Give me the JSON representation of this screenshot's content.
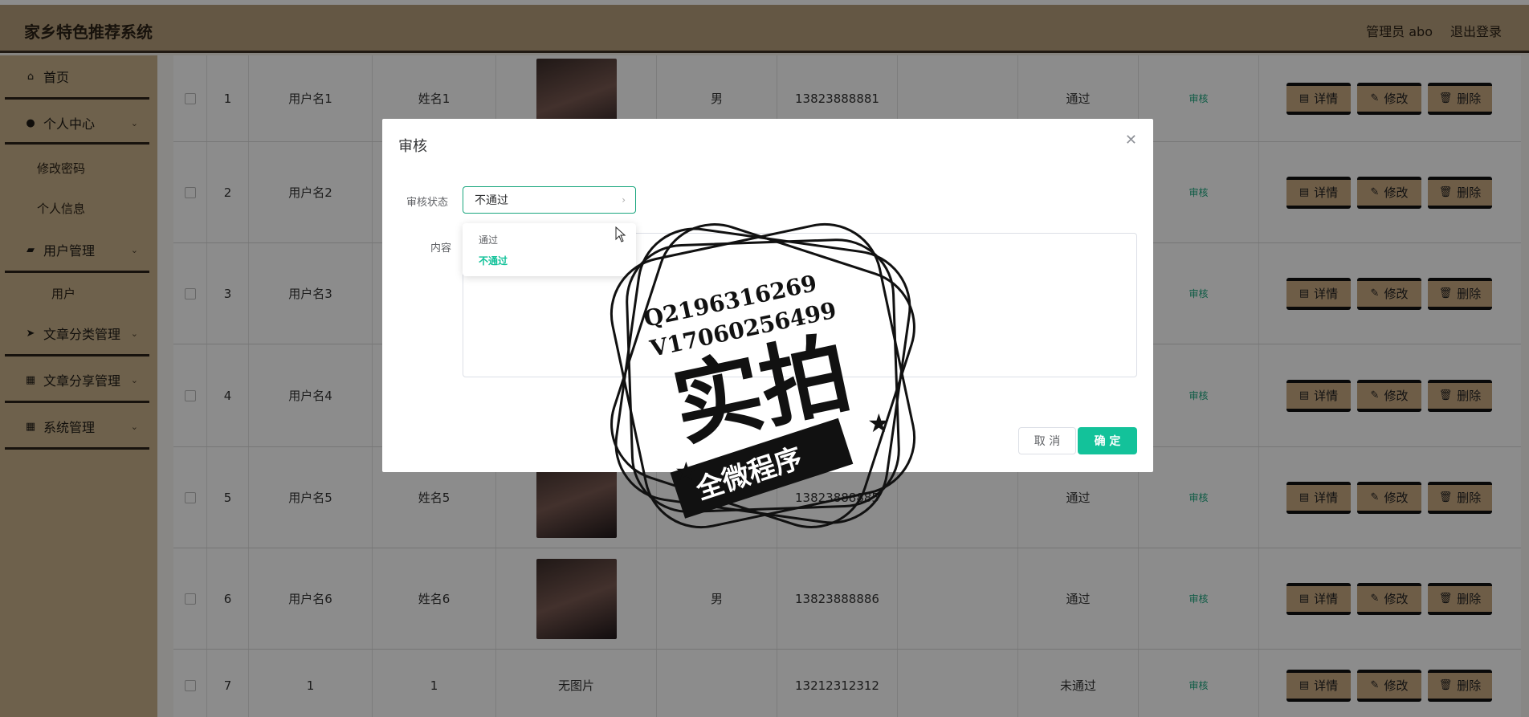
{
  "header": {
    "title": "家乡特色推荐系统",
    "admin_label": "管理员 abo",
    "logout_label": "退出登录"
  },
  "sidebar": {
    "items": [
      {
        "label": "首页",
        "icon": "home-icon"
      },
      {
        "label": "个人中心",
        "icon": "user-icon"
      },
      {
        "label": "修改密码"
      },
      {
        "label": "个人信息"
      },
      {
        "label": "用户管理",
        "icon": "ticket-icon"
      },
      {
        "label": "用户"
      },
      {
        "label": "文章分类管理",
        "icon": "send-icon"
      },
      {
        "label": "文章分享管理",
        "icon": "grid-icon"
      },
      {
        "label": "系统管理",
        "icon": "grid-icon"
      }
    ]
  },
  "table": {
    "rows": [
      {
        "index": "1",
        "username": "用户名1",
        "name": "姓名1",
        "photo": "photo",
        "gender": "男",
        "phone": "13823888881",
        "status": "通过"
      },
      {
        "index": "2",
        "username": "用户名2",
        "name": "",
        "photo": "",
        "gender": "",
        "phone": "",
        "status": ""
      },
      {
        "index": "3",
        "username": "用户名3",
        "name": "",
        "photo": "",
        "gender": "",
        "phone": "",
        "status": ""
      },
      {
        "index": "4",
        "username": "用户名4",
        "name": "",
        "photo": "",
        "gender": "",
        "phone": "",
        "status": ""
      },
      {
        "index": "5",
        "username": "用户名5",
        "name": "姓名5",
        "photo": "photo",
        "gender": "男",
        "phone": "13823888885",
        "status": "通过"
      },
      {
        "index": "6",
        "username": "用户名6",
        "name": "姓名6",
        "photo": "photo",
        "gender": "男",
        "phone": "13823888886",
        "status": "通过"
      },
      {
        "index": "7",
        "username": "1",
        "name": "1",
        "photo_text": "无图片",
        "gender": "",
        "phone": "13212312312",
        "status": "未通过"
      }
    ],
    "audit_label": "审核",
    "btn_detail": "详情",
    "btn_edit": "修改",
    "btn_delete": "删除"
  },
  "dialog": {
    "title": "审核",
    "status_label": "审核状态",
    "status_value": "不通过",
    "content_label": "内容",
    "options": [
      "通过",
      "不通过"
    ],
    "cancel_label": "取 消",
    "ok_label": "确 定"
  },
  "watermark": {
    "line1": "Q2196316269",
    "line2": "V17060256499",
    "main": "实拍",
    "ribbon": "全微程序"
  },
  "colors": {
    "header_bg": "#b69e7c",
    "sidebar_bg": "#c9b18b",
    "accent_green": "#13c29a",
    "button_bg": "#c9a982"
  }
}
